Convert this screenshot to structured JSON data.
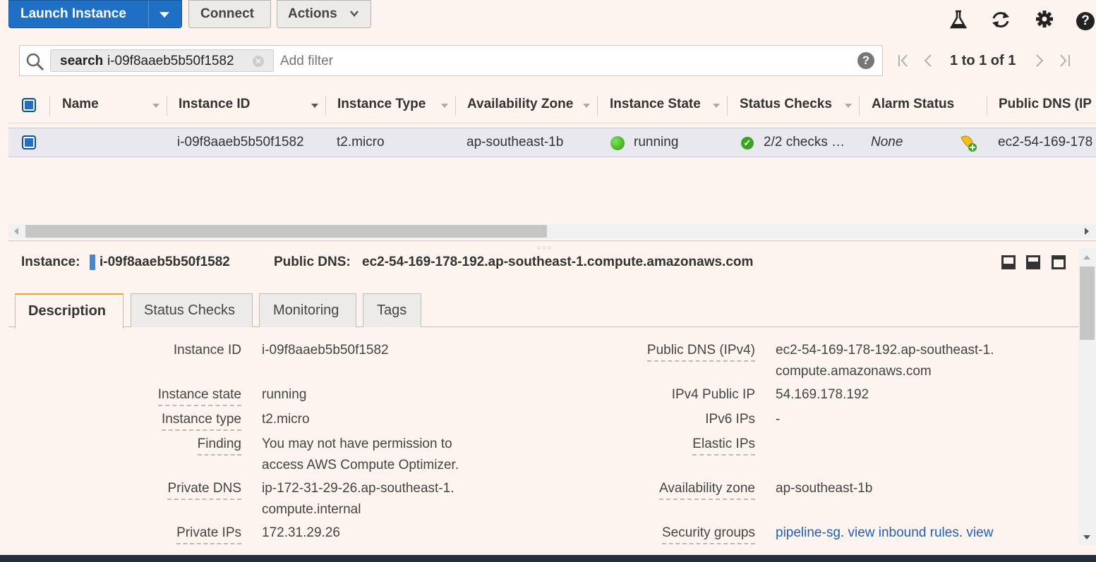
{
  "toolbar": {
    "launch_label": "Launch Instance",
    "connect_label": "Connect",
    "actions_label": "Actions"
  },
  "search": {
    "chip_key": "search",
    "chip_sep": ":",
    "chip_value": "i-09f8aaeb5b50f1582",
    "placeholder": "Add filter"
  },
  "pagination": {
    "text": "1 to 1 of 1"
  },
  "table": {
    "headers": [
      "Name",
      "Instance ID",
      "Instance Type",
      "Availability Zone",
      "Instance State",
      "Status Checks",
      "Alarm Status",
      "Public DNS (IP"
    ],
    "row": {
      "name": "",
      "instance_id": "i-09f8aaeb5b50f1582",
      "instance_type": "t2.micro",
      "availability_zone": "ap-southeast-1b",
      "instance_state": "running",
      "status_checks": "2/2 checks …",
      "alarm_status": "None",
      "public_dns": "ec2-54-169-178"
    }
  },
  "detail": {
    "instance_label": "Instance:",
    "instance_id": "i-09f8aaeb5b50f1582",
    "dns_label": "Public DNS:",
    "dns_value": "ec2-54-169-178-192.ap-southeast-1.compute.amazonaws.com",
    "tabs": [
      "Description",
      "Status Checks",
      "Monitoring",
      "Tags"
    ],
    "left": [
      {
        "label": "Instance ID",
        "value": "i-09f8aaeb5b50f1582"
      },
      {
        "label": "Instance state",
        "value": "running"
      },
      {
        "label": "Instance type",
        "value": "t2.micro"
      },
      {
        "label": "Finding",
        "value": "You may not have permission to access AWS Compute Optimizer."
      },
      {
        "label": "Private DNS",
        "value": "ip-172-31-29-26.ap-southeast-1.compute.internal"
      },
      {
        "label": "Private IPs",
        "value": "172.31.29.26"
      }
    ],
    "right": [
      {
        "label": "Public DNS (IPv4)",
        "value": "ec2-54-169-178-192.ap-southeast-1.compute.amazonaws.com"
      },
      {
        "label": "IPv4 Public IP",
        "value": "54.169.178.192"
      },
      {
        "label": "IPv6 IPs",
        "value": "-"
      },
      {
        "label": "Elastic IPs",
        "value": ""
      },
      {
        "label": "Availability zone",
        "value": "ap-southeast-1b"
      },
      {
        "label": "Security groups",
        "link1": "pipeline-sg",
        "sep1": ". ",
        "link2": "view inbound rules",
        "sep2": ". ",
        "link3": "view"
      }
    ]
  },
  "colors": {
    "primary": "#1f6fc5",
    "accent_tab": "#f0a429",
    "link": "#1e62b3",
    "running": "#3aa41f"
  }
}
